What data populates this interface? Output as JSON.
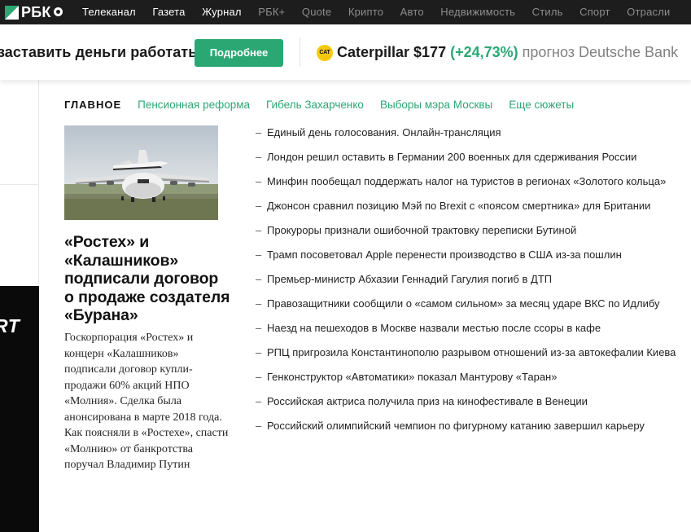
{
  "topnav": {
    "logo_text": "РБК",
    "items": [
      {
        "label": "Телеканал",
        "active": true
      },
      {
        "label": "Газета",
        "active": true
      },
      {
        "label": "Журнал",
        "active": true
      },
      {
        "label": "РБК+",
        "active": false
      },
      {
        "label": "Quote",
        "active": false
      },
      {
        "label": "Крипто",
        "active": false
      },
      {
        "label": "Авто",
        "active": false
      },
      {
        "label": "Недвижимость",
        "active": false
      },
      {
        "label": "Стиль",
        "active": false
      },
      {
        "label": "Спорт",
        "active": false
      },
      {
        "label": "Отрасли",
        "active": false
      }
    ]
  },
  "banner": {
    "text": "заставить деньги работать",
    "button_label": "Подробнее",
    "ticker_logo": "CAT",
    "ticker_name": "Caterpillar $177",
    "ticker_change": "(+24,73%)",
    "ticker_rest": "прогноз Deutsche Bank"
  },
  "left_promo_text": "RT",
  "subnav": {
    "main_label": "ГЛАВНОЕ",
    "links": [
      "Пенсионная реформа",
      "Гибель Захарченко",
      "Выборы мэра Москвы",
      "Еще сюжеты"
    ]
  },
  "lead": {
    "title": "«Ростех» и «Калашников» подписали договор о продаже создателя «Бурана»",
    "text": "Госкорпорация «Ростех» и концерн «Калашников» подписали договор купли-продажи 60% акций НПО «Молния». Сделка была анонсирована в марте 2018 года. Как поясняли в «Ростехе», спасти «Молнию» от банкротства поручал Владимир Путин"
  },
  "news": {
    "dash": "–",
    "items": [
      "Единый день голосования. Онлайн-трансляция",
      "Лондон решил оставить в Германии 200 военных для сдерживания России",
      "Минфин пообещал поддержать налог на туристов в регионах «Золотого кольца»",
      "Джонсон сравнил позицию Мэй по Brexit с «поясом смертника» для Британии",
      "Прокуроры признали ошибочной трактовку переписки Бутиной",
      "Трамп посоветовал Apple перенести производство в США из-за пошлин",
      "Премьер-министр Абхазии Геннадий Гагулия погиб в ДТП",
      "Правозащитники сообщили о «самом сильном» за месяц ударе ВКС по Идлибу",
      "Наезд на пешеходов в Москве назвали местью после ссоры в кафе",
      "РПЦ пригрозила Константинополю разрывом отношений из-за автокефалии Киева",
      "Генконструктор «Автоматики» показал Мантурову «Таран»",
      "Российская актриса получила приз на кинофестивале в Венеции",
      "Российский олимпийский чемпион по фигурному катанию завершил карьеру"
    ]
  },
  "colors": {
    "accent": "#2ba774",
    "nav_bg": "#1d1d1d",
    "nav_muted": "#8d8d8d",
    "cat_yellow": "#f4c90c"
  }
}
